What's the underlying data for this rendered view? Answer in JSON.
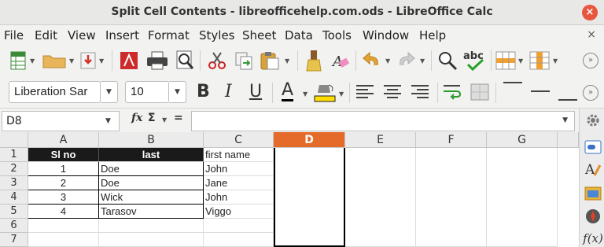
{
  "window": {
    "title": "Split Cell Contents - libreofficehelp.com.ods - LibreOffice Calc",
    "close_glyph": "×"
  },
  "menu": {
    "items": [
      "File",
      "Edit",
      "View",
      "Insert",
      "Format",
      "Styles",
      "Sheet",
      "Data",
      "Tools",
      "Window",
      "Help"
    ],
    "close_glyph": "×"
  },
  "toolbar": {
    "icons": [
      "new-document",
      "open-folder",
      "save",
      "export-pdf",
      "print",
      "print-preview",
      "cut",
      "copy",
      "paste",
      "clone-formatting",
      "clear-formatting",
      "undo",
      "redo",
      "find-replace",
      "spelling",
      "row",
      "column"
    ],
    "more_glyph": "»"
  },
  "format_toolbar": {
    "font_name": "Liberation Sar",
    "font_size": "10",
    "bold": "B",
    "italic": "I",
    "underline": "U",
    "font_color_glyph": "A",
    "font_color": "#000000",
    "highlight_color": "#ffdd00",
    "more_glyph": "»"
  },
  "formula_bar": {
    "name_box": "D8",
    "fx": "fx",
    "sigma": "Σ",
    "equals": "=",
    "formula": ""
  },
  "grid": {
    "columns": [
      "A",
      "B",
      "C",
      "D",
      "E",
      "F",
      "G"
    ],
    "selected_column": "D",
    "rows": [
      "1",
      "2",
      "3",
      "4",
      "5",
      "6",
      "7"
    ],
    "header": {
      "a": "Sl no",
      "b": "last",
      "c": "first name"
    },
    "data": [
      {
        "no": "1",
        "last": "Doe",
        "first": "John"
      },
      {
        "no": "2",
        "last": "Doe",
        "first": "Jane"
      },
      {
        "no": "3",
        "last": "Wick",
        "first": "John"
      },
      {
        "no": "4",
        "last": "Tarasov",
        "first": "Viggo"
      }
    ]
  },
  "sidebar": {
    "icons": [
      "properties",
      "styles",
      "gallery",
      "navigator",
      "functions"
    ],
    "functions_glyph": "f(x)"
  },
  "colors": {
    "selected_column": "#e56b2b",
    "header_fill": "#1a1a1a",
    "close": "#e9563e"
  }
}
